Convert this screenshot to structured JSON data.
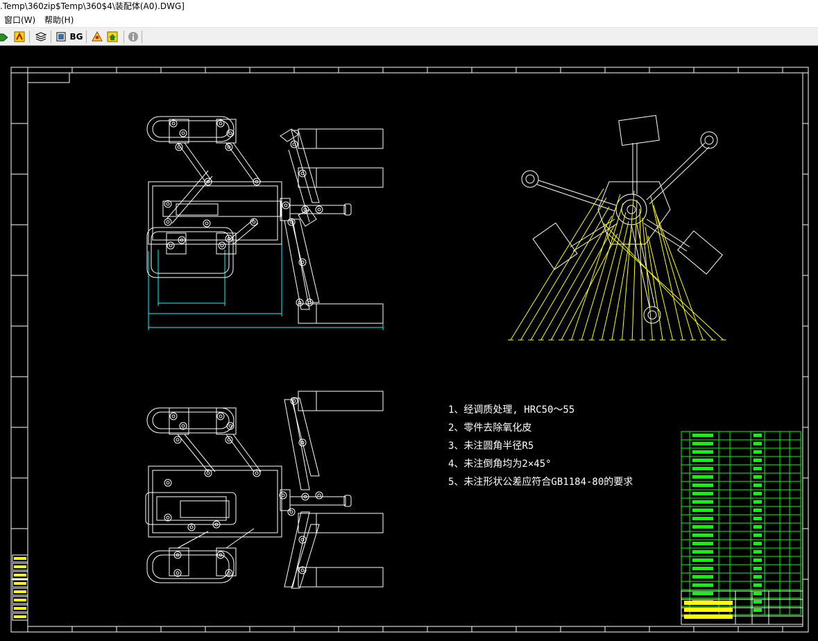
{
  "window": {
    "title": ".Temp\\360zip$Temp\\360$4\\装配体(A0).DWG]"
  },
  "menu": {
    "window_label": "窗口(W)",
    "help_label": "帮助(H)"
  },
  "toolbar": {
    "bg_label": "BG"
  },
  "drawing": {
    "notes": [
      "1、经调质处理, HRC50～55",
      "2、零件去除氧化皮",
      "3、未注圆角半径R5",
      "4、未注倒角均为2×45°",
      "5、未注形状公差应符合GB1184-80的要求"
    ],
    "colors": {
      "line_white": "#ffffff",
      "line_yellow": "#ffff00",
      "line_cyan": "#00ffff",
      "line_green": "#00ff00",
      "background": "#000000",
      "toolbar_bg": "#f0f0f0"
    }
  }
}
